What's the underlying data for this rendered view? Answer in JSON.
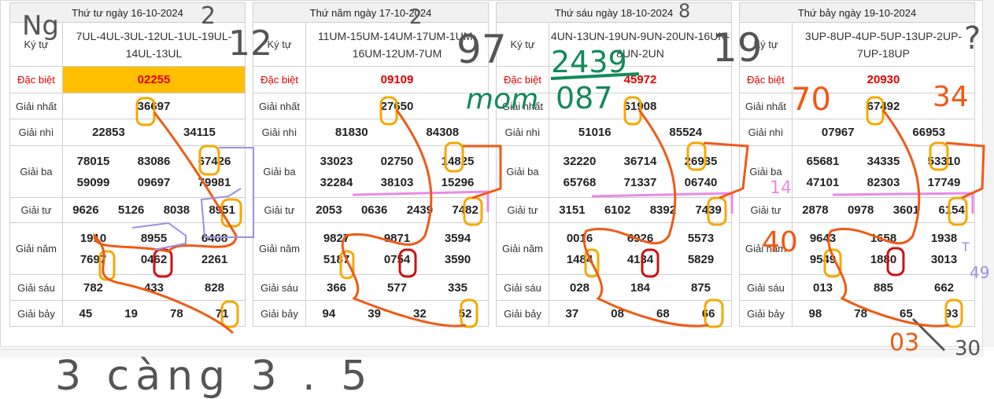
{
  "boards": [
    {
      "date": "Thứ tư ngày 16-10-2024",
      "kytu_label": "Ký tự",
      "kytu": "7UL-4UL-3UL-12UL-1UL-19UL-14UL-13UL",
      "labels": {
        "db": "Đặc biệt",
        "g1": "Giải nhất",
        "g2": "Giải nhì",
        "g3": "Giải ba",
        "g4": "Giải tư",
        "g5": "Giải năm",
        "g6": "Giải sáu",
        "g7": "Giải bảy"
      },
      "db": "02255",
      "g1": "36697",
      "g2": [
        "22853",
        "34115"
      ],
      "g3": [
        "78015",
        "83086",
        "67426",
        "59099",
        "09697",
        "79981"
      ],
      "g4": [
        "9626",
        "5126",
        "8038",
        "8951"
      ],
      "g5": [
        "1910",
        "8955",
        "6468",
        "7697",
        "0462",
        "2261"
      ],
      "g6": [
        "782",
        "433",
        "828"
      ],
      "g7": [
        "45",
        "19",
        "78",
        "71"
      ]
    },
    {
      "date": "Thứ năm ngày 17-10-2024",
      "kytu_label": "Ký tự",
      "kytu": "11UM-15UM-14UM-17UM-1UM-16UM-12UM-7UM",
      "labels": {
        "db": "Đặc biệt",
        "g1": "Giải nhất",
        "g2": "Giải nhì",
        "g3": "Giải ba",
        "g4": "Giải tư",
        "g5": "Giải năm",
        "g6": "Giải sáu",
        "g7": "Giải bảy"
      },
      "db": "09109",
      "g1": "27650",
      "g2": [
        "81830",
        "84308"
      ],
      "g3": [
        "33023",
        "02750",
        "14825",
        "32284",
        "38103",
        "15296"
      ],
      "g4": [
        "2053",
        "0636",
        "2439",
        "7482"
      ],
      "g5": [
        "9827",
        "9871",
        "3594",
        "5187",
        "0754",
        "3590"
      ],
      "g6": [
        "366",
        "577",
        "335"
      ],
      "g7": [
        "94",
        "39",
        "32",
        "52"
      ]
    },
    {
      "date": "Thứ sáu ngày 18-10-2024",
      "kytu_label": "Ký tự",
      "kytu": "4UN-13UN-19UN-9UN-20UN-16UN-8UN-2UN",
      "labels": {
        "db": "Đặc biệt",
        "g1": "Giải nhất",
        "g2": "Giải nhì",
        "g3": "Giải ba",
        "g4": "Giải tư",
        "g5": "Giải năm",
        "g6": "Giải sáu",
        "g7": "Giải bảy"
      },
      "db": "45972",
      "g1": "61908",
      "g2": [
        "51016",
        "85524"
      ],
      "g3": [
        "32220",
        "36714",
        "26935",
        "65768",
        "71337",
        "06740"
      ],
      "g4": [
        "3151",
        "6102",
        "8392",
        "7439"
      ],
      "g5": [
        "0016",
        "6926",
        "5573",
        "1484",
        "4134",
        "5829"
      ],
      "g6": [
        "028",
        "184",
        "875"
      ],
      "g7": [
        "37",
        "08",
        "68",
        "66"
      ]
    },
    {
      "date": "Thứ bảy ngày 19-10-2024",
      "kytu_label": "Ký tự",
      "kytu": "3UP-8UP-4UP-5UP-13UP-2UP-7UP-18UP",
      "labels": {
        "db": "Đặc biệt",
        "g1": "Giải nhất",
        "g2": "Giải nhì",
        "g3": "Giải ba",
        "g4": "Giải tư",
        "g5": "Giải năm",
        "g6": "Giải sáu",
        "g7": "Giải bảy"
      },
      "db": "20930",
      "g1": "67492",
      "g2": [
        "07967",
        "66953"
      ],
      "g3": [
        "65681",
        "34335",
        "53310",
        "47101",
        "82303",
        "17749"
      ],
      "g4": [
        "2878",
        "0978",
        "3601",
        "6154"
      ],
      "g5": [
        "9643",
        "1658",
        "1938",
        "9549",
        "1880",
        "3013"
      ],
      "g6": [
        "013",
        "885",
        "662"
      ],
      "g7": [
        "98",
        "78",
        "65",
        "93"
      ]
    }
  ],
  "annotations": {
    "top_left": "Ng",
    "b1_top": "2",
    "b1_right": "12",
    "b2_top": "2",
    "b2_right": "97",
    "b3_top": "8",
    "b3_right": "19",
    "b4_right": "?",
    "green_calc_top": "2439",
    "green_calc_bottom": "087",
    "green_word": "mom",
    "red_70": "70",
    "red_34": "34",
    "pink_14": "14",
    "red_40": "40",
    "blue_t": "T",
    "blue_49": "49",
    "red_03": "03",
    "red_30": "30",
    "bottom_note": "3 càng 3 . 5"
  },
  "colors": {
    "gold": "#ffbf00",
    "red": "#e00000",
    "orange_ink": "#f05a14",
    "gold_ink": "#f5a800",
    "purple_ink": "#9b8fe6",
    "pink_ink": "#e98ae8",
    "green_ink": "#138a5a",
    "gray_ink": "#555555",
    "dark_red_ink": "#cc1111"
  }
}
